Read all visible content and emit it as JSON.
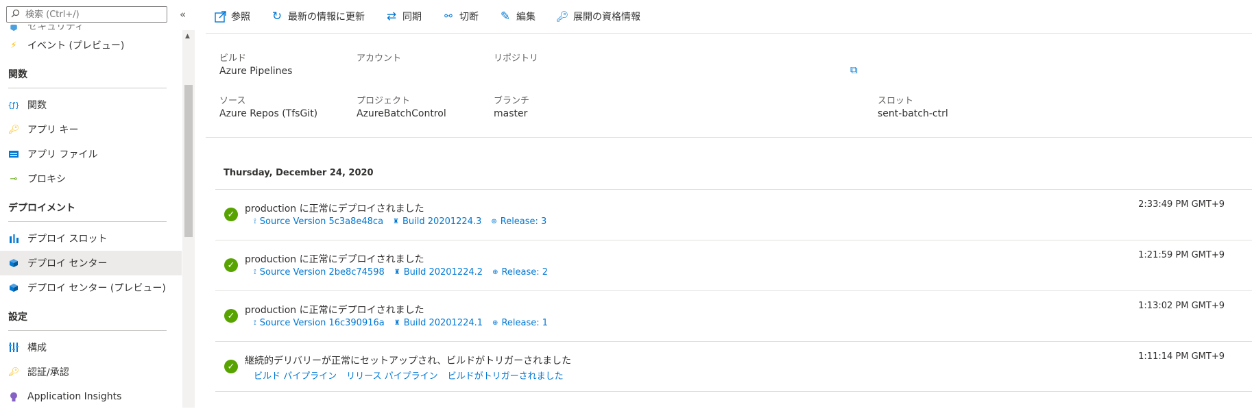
{
  "search": {
    "placeholder": "検索 (Ctrl+/)"
  },
  "sidebar": {
    "partial_item": "セキュリティ",
    "events_item": "イベント (プレビュー)",
    "sections": [
      {
        "title": "関数",
        "items": [
          "関数",
          "アプリ キー",
          "アプリ ファイル",
          "プロキシ"
        ]
      },
      {
        "title": "デプロイメント",
        "items": [
          "デプロイ スロット",
          "デプロイ センター",
          "デプロイ センター (プレビュー)"
        ]
      },
      {
        "title": "設定",
        "items": [
          "構成",
          "認証/承認",
          "Application Insights"
        ]
      }
    ]
  },
  "toolbar": {
    "browse": "参照",
    "refresh": "最新の情報に更新",
    "sync": "同期",
    "disconnect": "切断",
    "edit": "編集",
    "credentials": "展開の資格情報"
  },
  "summary": {
    "build_label": "ビルド",
    "build_value": "Azure Pipelines",
    "account_label": "アカウント",
    "repo_label": "リポジトリ",
    "source_label": "ソース",
    "source_value": "Azure Repos (TfsGit)",
    "project_label": "プロジェクト",
    "project_value": "AzureBatchControl",
    "branch_label": "ブランチ",
    "branch_value": "master",
    "slot_label": "スロット",
    "slot_value": "sent-batch-ctrl"
  },
  "timeline": {
    "day": "Thursday, December 24, 2020",
    "events": [
      {
        "title": "production に正常にデプロイされました",
        "time": "2:33:49 PM GMT+9",
        "links": [
          "Source Version 5c3a8e48ca",
          "Build 20201224.3",
          "Release: 3"
        ]
      },
      {
        "title": "production に正常にデプロイされました",
        "time": "1:21:59 PM GMT+9",
        "links": [
          "Source Version 2be8c74598",
          "Build 20201224.2",
          "Release: 2"
        ]
      },
      {
        "title": "production に正常にデプロイされました",
        "time": "1:13:02 PM GMT+9",
        "links": [
          "Source Version 16c390916a",
          "Build 20201224.1",
          "Release: 1"
        ]
      },
      {
        "title": "継続的デリバリーが正常にセットアップされ、ビルドがトリガーされました",
        "time": "1:11:14 PM GMT+9",
        "links": [
          "ビルド パイプライン",
          "リリース パイプライン",
          "ビルドがトリガーされました"
        ]
      }
    ]
  },
  "colors": {
    "accent": "#0078d4",
    "success": "#57a300",
    "selected_bg": "#edebe9"
  }
}
